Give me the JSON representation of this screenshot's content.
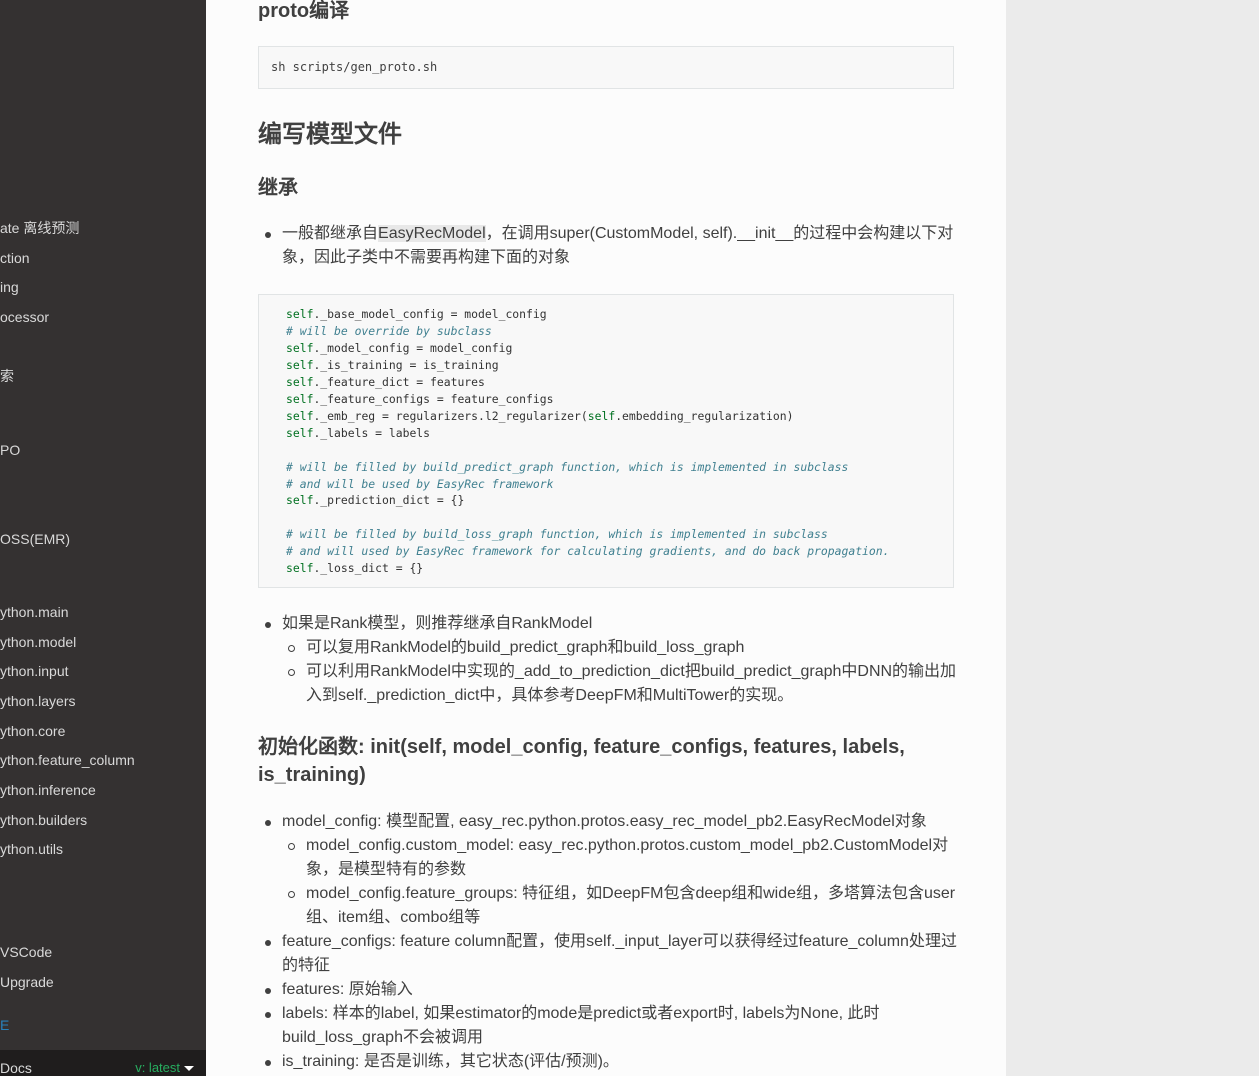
{
  "sidebar": {
    "items": [
      {
        "label": "ate 离线预测"
      },
      {
        "label": "ction"
      },
      {
        "label": "ing"
      },
      {
        "label": "ocessor"
      },
      {
        "label": "索"
      },
      {
        "label": "PO"
      },
      {
        "label": "OSS(EMR)"
      },
      {
        "label": "ython.main"
      },
      {
        "label": "ython.model"
      },
      {
        "label": "ython.input"
      },
      {
        "label": "ython.layers"
      },
      {
        "label": "ython.core"
      },
      {
        "label": "ython.feature_column"
      },
      {
        "label": "ython.inference"
      },
      {
        "label": "ython.builders"
      },
      {
        "label": "ython.utils"
      },
      {
        "label": "VSCode"
      },
      {
        "label": "Upgrade"
      },
      {
        "label": "E"
      }
    ],
    "footer": {
      "docs": "Docs",
      "version": "v: latest"
    }
  },
  "content": {
    "proto_heading": "proto编译",
    "proto_cmd": "sh scripts/gen_proto.sh",
    "h_write_model": "编写模型文件",
    "h_inherit": "继承",
    "inherit_p1_a": "一般都继承自",
    "inherit_p1_hl": "EasyRecModel",
    "inherit_p1_b": "，在调用super(CustomModel, self).__init__的过程中会构建以下对",
    "inherit_p1_c": "象，因此子类中不需要再构建下面的对象",
    "code": {
      "self": "self",
      "l1": "._base_model_config = model_config",
      "c1": "# will be override by subclass",
      "l2": "._model_config = model_config",
      "l3": "._is_training = is_training",
      "l4": "._feature_dict = features",
      "l5": "._feature_configs = feature_configs",
      "l6a": "._emb_reg = regularizers.l2_regularizer(",
      "l6b": ".embedding_regularization)",
      "l7": "._labels = labels",
      "c2": "# will be filled by build_predict_graph function, which is implemented in subclass",
      "c3": "# and will be used by EasyRec framework",
      "l8": "._prediction_dict = {}",
      "c4": "# will be filled by build_loss_graph function, which is implemented in subclass",
      "c5": "# and will used by EasyRec framework for calculating gradients, and do back propagation.",
      "l9": "._loss_dict = {}"
    },
    "rank_p": "如果是Rank模型，则推荐继承自RankModel",
    "rank_s1": "可以复用RankModel的build_predict_graph和build_loss_graph",
    "rank_s2a": "可以利用RankModel中实现的_add_to_prediction_dict把build_predict_graph中DNN的输出加",
    "rank_s2b": "入到self._prediction_dict中，具体参考DeepFM和MultiTower的实现。",
    "h_init_a": "初始化函数: init(self, model_config, feature_configs, features, labels,",
    "h_init_b": "is_training)",
    "init_mc": "model_config: 模型配置, easy_rec.python.protos.easy_rec_model_pb2.EasyRecModel对象",
    "init_mc_s1a": "model_config.custom_model: easy_rec.python.protos.custom_model_pb2.CustomModel对",
    "init_mc_s1b": "象，是模型特有的参数",
    "init_mc_s2a": "model_config.feature_groups: 特征组，如DeepFM包含deep组和wide组，多塔算法包含user",
    "init_mc_s2b": "组、item组、combo组等",
    "init_fc_a": "feature_configs: feature column配置，使用self._input_layer可以获得经过feature_column处理过",
    "init_fc_b": "的特征",
    "init_features": "features: 原始输入",
    "init_labels_a": "labels: 样本的label, 如果estimator的mode是predict或者export时, labels为None, 此时",
    "init_labels_b": "build_loss_graph不会被调用",
    "init_training": "is_training: 是否是训练，其它状态(评估/预测)。"
  }
}
